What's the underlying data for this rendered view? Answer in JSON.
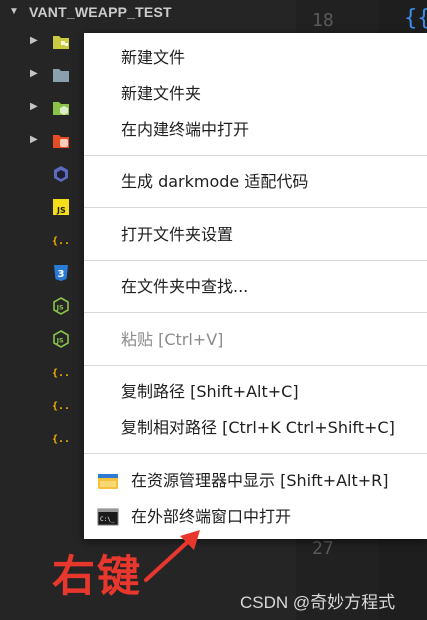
{
  "explorer": {
    "root_title": "VANT_WEAPP_TEST"
  },
  "tree_items": [
    {
      "icon": "folder-icon",
      "expandable": true,
      "color": "#cbcb41"
    },
    {
      "icon": "folder-icon",
      "expandable": true,
      "color": "#8aa0ad"
    },
    {
      "icon": "node-folder-icon",
      "expandable": true,
      "color": "#8bc34a"
    },
    {
      "icon": "html-folder-icon",
      "expandable": true,
      "color": "#e44d26"
    },
    {
      "icon": "hexagon-icon",
      "expandable": false,
      "color": "#5c6bc0"
    },
    {
      "icon": "js-file-icon",
      "expandable": false,
      "color": "#f5de19",
      "glyph": "JS"
    },
    {
      "icon": "json-file-icon",
      "expandable": false,
      "color": "#f5b400",
      "glyph": "{..}"
    },
    {
      "icon": "css-file-icon",
      "expandable": false,
      "color": "#2a7bd6",
      "glyph": "3"
    },
    {
      "icon": "node-js-icon",
      "expandable": false,
      "color": "#8bc34a",
      "glyph": "JS"
    },
    {
      "icon": "node-js-icon",
      "expandable": false,
      "color": "#8bc34a",
      "glyph": "JS"
    },
    {
      "icon": "json-file-icon",
      "expandable": false,
      "color": "#f5b400",
      "glyph": "{..}"
    },
    {
      "icon": "json-file-icon",
      "expandable": false,
      "color": "#f5b400",
      "glyph": "{..}"
    },
    {
      "icon": "json-file-icon",
      "expandable": false,
      "color": "#f5b400",
      "glyph": "{..}"
    }
  ],
  "editor": {
    "line_top": "18",
    "line_bottom": "27",
    "brace_text": "{{"
  },
  "context_menu": {
    "new_file": "新建文件",
    "new_folder": "新建文件夹",
    "open_in_terminal": "在内建终端中打开",
    "generate_darkmode": "生成 darkmode 适配代码",
    "open_folder_settings": "打开文件夹设置",
    "find_in_folder": "在文件夹中查找...",
    "paste": "粘贴  [Ctrl+V]",
    "copy_path": "复制路径  [Shift+Alt+C]",
    "copy_relative_path": "复制相对路径  [Ctrl+K Ctrl+Shift+C]",
    "reveal_in_explorer": "在资源管理器中显示  [Shift+Alt+R]",
    "open_in_external_terminal": "在外部终端窗口中打开"
  },
  "annotation": {
    "text": "右键",
    "color": "#e8372c"
  },
  "watermark": "CSDN @奇妙方程式"
}
